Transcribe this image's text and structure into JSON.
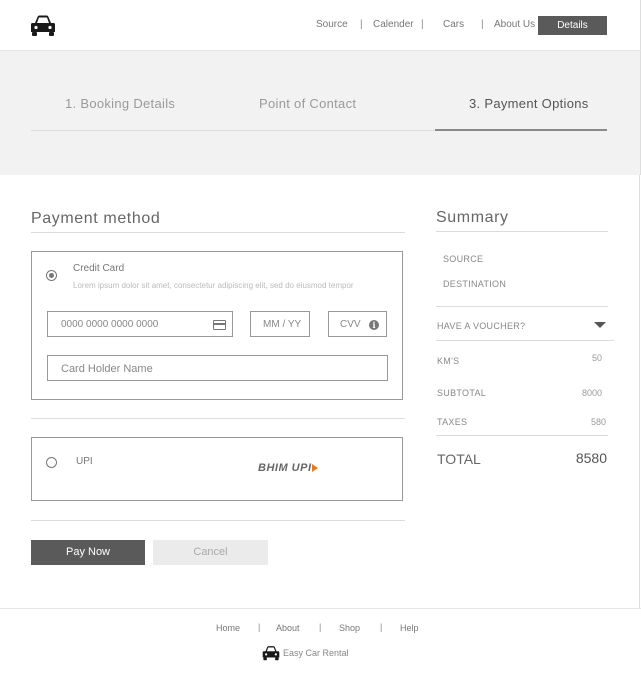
{
  "header": {
    "logo_icon": "car-icon",
    "nav": [
      "Source",
      "Calender",
      "Cars",
      "About Us"
    ],
    "details_label": "Details"
  },
  "steps": {
    "items": [
      "1. Booking Details",
      "Point of Contact",
      "3. Payment Options"
    ],
    "active_index": 2
  },
  "payment": {
    "title": "Payment method",
    "credit_card": {
      "label": "Credit Card",
      "description": "Lorem ipsum dolor sit amet, consectetur adipiscing elit, sed do eiusmod tempor",
      "selected": true,
      "card_number_placeholder": "0000   0000   0000   0000",
      "expiry_placeholder": "MM / YY",
      "cvv_placeholder": "CVV",
      "holder_placeholder": "Card Holder Name"
    },
    "upi": {
      "label": "UPI",
      "selected": false,
      "logo_text": "BHIM UPI"
    },
    "pay_label": "Pay Now",
    "cancel_label": "Cancel"
  },
  "summary": {
    "title": "Summary",
    "source_label": "SOURCE",
    "destination_label": "DESTINATION",
    "voucher_label": "HAVE A VOUCHER?",
    "kms_label": "KM'S",
    "kms_value": "50",
    "subtotal_label": "SUBTOTAL",
    "subtotal_value": "8000",
    "taxes_label": "TAXES",
    "taxes_value": "580",
    "total_label": "TOTAL",
    "total_value": "8580"
  },
  "footer": {
    "nav": [
      "Home",
      "About",
      "Shop",
      "Help"
    ],
    "brand": "Easy Car Rental"
  },
  "colors": {
    "primary_button": "#5a5a5a",
    "banner_bg": "#f2f2f2",
    "upi_accent": "#e87a1e"
  }
}
